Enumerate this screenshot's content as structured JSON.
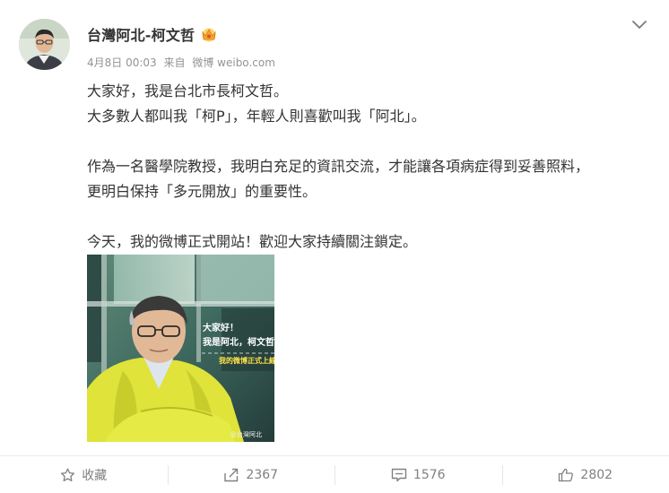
{
  "post": {
    "author": "台灣阿北-柯文哲",
    "badge_icon": "crown-badge-icon",
    "date": "4月8日 00:03",
    "source_prefix": "来自",
    "source": "微博 weibo.com",
    "paragraphs": [
      [
        "大家好，我是台北市長柯文哲。",
        "大多數人都叫我「柯P」，年輕人則喜歡叫我「阿北」。"
      ],
      [
        "作為一名醫學院教授，我明白充足的資訊交流，才能讓各項病症得到妥善照料，",
        "更明白保持「多元開放」的重要性。"
      ],
      [
        "今天，我的微博正式開站！歡迎大家持續關注鎖定。"
      ]
    ],
    "image": {
      "caption_line1": "大家好！",
      "caption_line2": "我是阿北，柯文哲",
      "caption_line3": "我的微博正式上線",
      "watermark": "@台灣阿北"
    }
  },
  "actions": {
    "favorite_label": "收藏",
    "repost_count": "2367",
    "comment_count": "1576",
    "like_count": "2802"
  },
  "colors": {
    "accent_gold": "#f0a72b",
    "text_primary": "#333333",
    "text_meta": "#939393"
  }
}
